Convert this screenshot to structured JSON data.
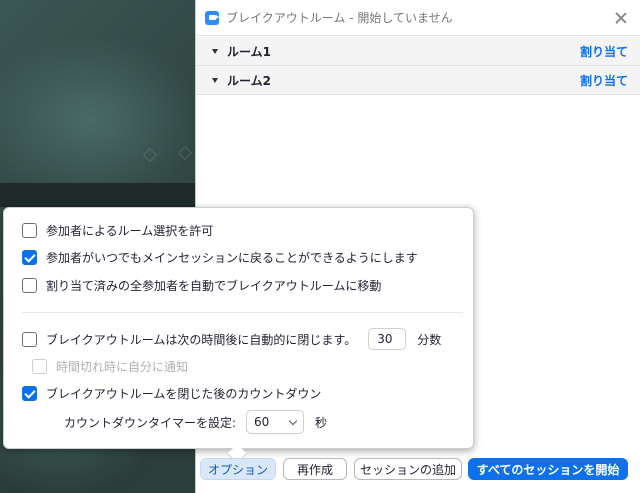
{
  "window": {
    "title": "ブレイクアウトルーム - 開始していません",
    "rooms": [
      {
        "name": "ルーム1",
        "assign_label": "割り当て"
      },
      {
        "name": "ルーム2",
        "assign_label": "割り当て"
      }
    ]
  },
  "options_popover": {
    "allow_choose_room": {
      "label": "参加者によるルーム選択を許可",
      "checked": false
    },
    "allow_return_anytime": {
      "label": "参加者がいつでもメインセッションに戻ることができるようにします",
      "checked": true
    },
    "auto_move": {
      "label": "割り当て済みの全参加者を自動でブレイクアウトルームに移動",
      "checked": false
    },
    "auto_close": {
      "label": "ブレイクアウトルームは次の時間後に自動的に閉じます。",
      "value": "30",
      "unit": "分数",
      "checked": false
    },
    "notify_on_timeout": {
      "label": "時間切れ時に自分に通知",
      "checked": false,
      "disabled": true
    },
    "countdown": {
      "label": "ブレイクアウトルームを閉じた後のカウントダウン",
      "checked": true
    },
    "countdown_timer": {
      "label": "カウントダウンタイマーを設定:",
      "value": "60",
      "unit": "秒"
    }
  },
  "buttons": {
    "options": "オプション",
    "recreate": "再作成",
    "add_session": "セッションの追加",
    "start_all": "すべてのセッションを開始"
  },
  "colors": {
    "accent": "#0e71eb",
    "options_bg": "#d9e7f8",
    "background": "#2b3d3a"
  },
  "icons": [
    "zoom-app-icon",
    "close-icon",
    "expand-triangle-icon",
    "checkbox-icon",
    "chevron-down-icon"
  ]
}
